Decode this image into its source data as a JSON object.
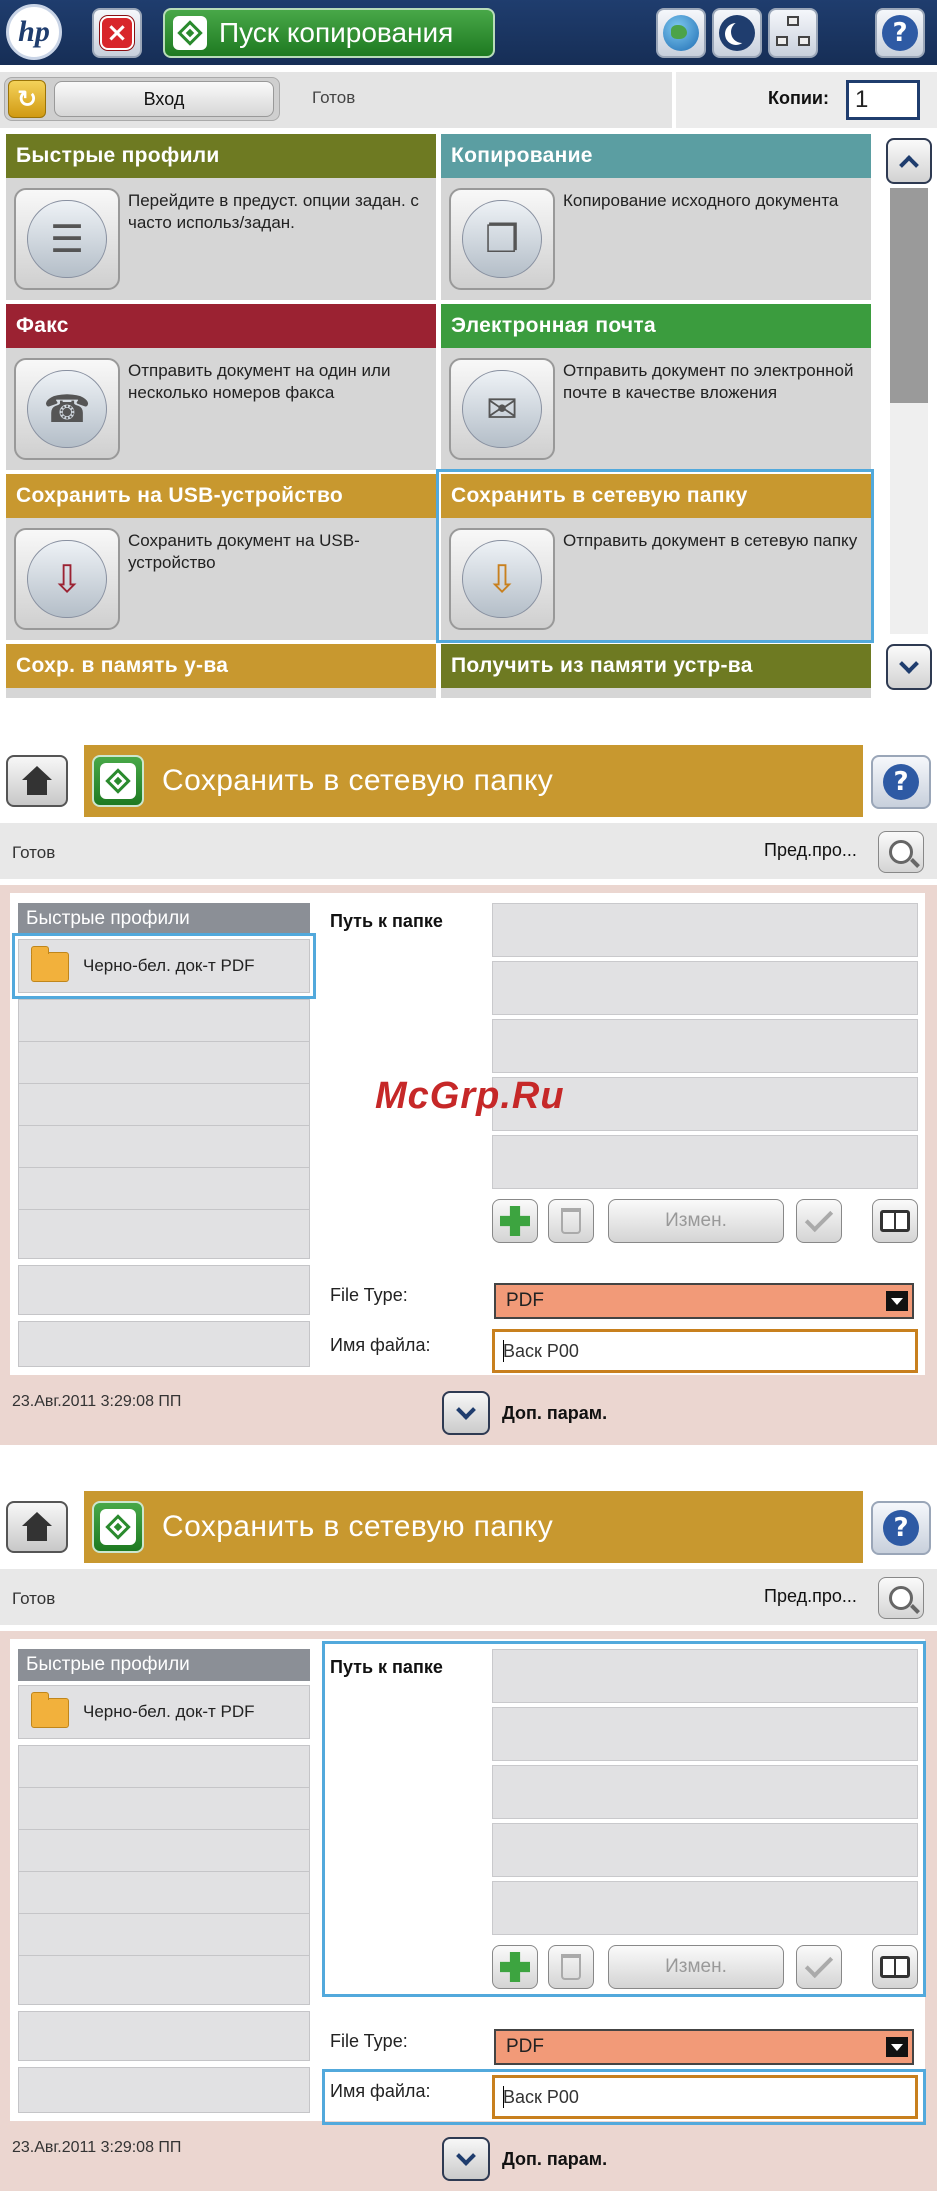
{
  "screen1": {
    "start_copy_label": "Пуск копирования",
    "help": "?",
    "status": {
      "login_label": "Вход",
      "status_text": "Готов",
      "copies_label": "Копии:",
      "copies_value": "1"
    },
    "tiles": [
      {
        "title": "Быстрые профили",
        "desc": "Перейдите в предуст. опции задан. с часто использ/задан.",
        "color": "#6e7a22",
        "icon": "quick-sets-icon",
        "glyph": "☰"
      },
      {
        "title": "Копирование",
        "desc": "Копирование исходного документа",
        "color": "#5b9ea2",
        "icon": "copy-icon",
        "glyph": "❐"
      },
      {
        "title": "Факс",
        "desc": "Отправить документ на один или несколько номеров факса",
        "color": "#9b2232",
        "icon": "fax-icon",
        "glyph": "☎"
      },
      {
        "title": "Электронная почта",
        "desc": "Отправить документ по электронной почте в качестве вложения",
        "color": "#3b9c3e",
        "icon": "email-icon",
        "glyph": "✉"
      },
      {
        "title": "Сохранить на USB-устройство",
        "desc": "Сохранить документ на USB-устройство",
        "color": "#c8982f",
        "icon": "usb-icon",
        "glyph": "⇩"
      },
      {
        "title": "Сохранить в сетевую папку",
        "desc": "Отправить документ в сетевую папку",
        "color": "#c8982f",
        "icon": "network-folder-icon",
        "glyph": "⇩"
      },
      {
        "title": "Сохр. в память у-ва",
        "desc": "",
        "color": "#c8982f",
        "icon": "",
        "glyph": ""
      },
      {
        "title": "Получить из памяти устр-ва",
        "desc": "",
        "color": "#6e7a22",
        "icon": "",
        "glyph": ""
      }
    ]
  },
  "screen2": {
    "title": "Сохранить в сетевую папку",
    "status_text": "Готов",
    "preview_label": "Пред.про...",
    "quick_sets_header": "Быстрые профили",
    "quick_set_item": "Черно-бел. док-т PDF",
    "folder_path_label": "Путь к папке",
    "edit_label": "Измен.",
    "file_type_label": "File Type:",
    "file_type_value": "PDF",
    "file_name_label": "Имя файла:",
    "file_name_value": "Васк Р00",
    "datetime": "23.Авг.2011 3:29:08 ПП",
    "more_options": "Доп. парам."
  },
  "watermark": "McGrp.Ru",
  "colors": {
    "highlight": "#52a9dc",
    "title_gold": "#c8982f",
    "navy": "#1f3d6e"
  }
}
